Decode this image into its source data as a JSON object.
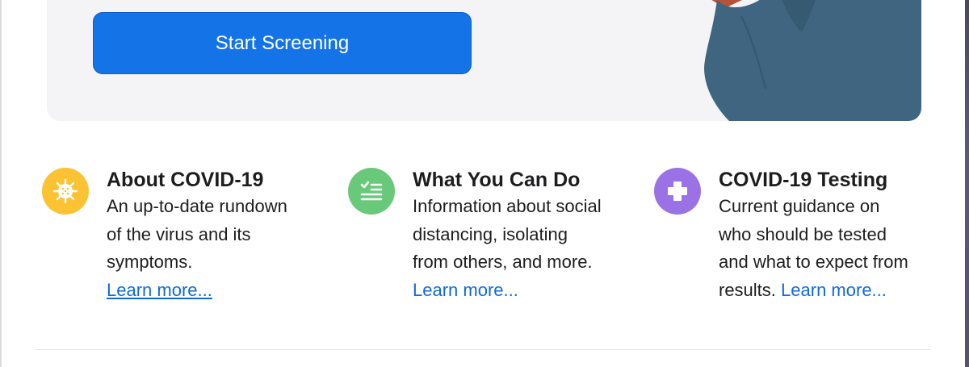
{
  "hero": {
    "cta_label": "Start Screening",
    "colors": {
      "background": "#f4f4f6",
      "cta": "#1473e6",
      "sleeve": "#3f6580",
      "hand": "#b5533a"
    }
  },
  "cards": [
    {
      "icon": "virus-icon",
      "icon_color": "#fbc234",
      "title": "About COVID-19",
      "lines": [
        "An up-to-date rundown",
        "of the virus and its",
        "symptoms."
      ],
      "link": "Learn more..."
    },
    {
      "icon": "checklist-icon",
      "icon_color": "#69c97a",
      "title": "What You Can Do",
      "lines": [
        "Information about social",
        "distancing, isolating",
        "from others, and more."
      ],
      "link": "Learn more..."
    },
    {
      "icon": "medical-cross-icon",
      "icon_color": "#9b72e6",
      "title": "COVID-19 Testing",
      "lines": [
        "Current guidance on",
        "who should be tested",
        "and what to expect from",
        "results."
      ],
      "link": "Learn more..."
    }
  ]
}
